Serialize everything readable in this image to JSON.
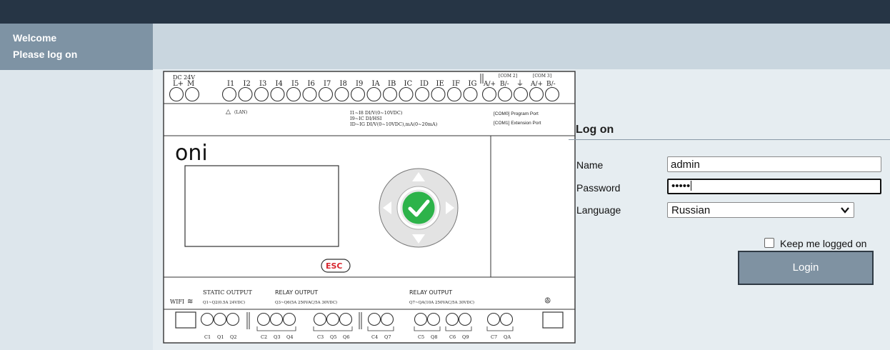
{
  "sidebar": {
    "welcome": "Welcome",
    "prompt": "Please log on"
  },
  "device": {
    "power_labels": [
      "DC 24V",
      "L+",
      "M"
    ],
    "input_labels": [
      "I1",
      "I2",
      "I3",
      "I4",
      "I5",
      "I6",
      "I7",
      "I8",
      "I9",
      "IA",
      "IB",
      "IC",
      "ID",
      "IE",
      "IF",
      "IG"
    ],
    "com2_label": "[COM 2]",
    "com3_label": "[COM 3]",
    "com_pins": [
      "A/+",
      "B/-",
      "A/+",
      "B/-"
    ],
    "lan_label": "(LAN)",
    "input_spec_lines": [
      "I1~I8 DI/V(0~10VDC)",
      "I9~IC DI/HSI",
      "ID~IG DI/V(0~10VDC),mA(0~20mA)"
    ],
    "port_lines": [
      "[COM0] Program Port",
      "[COM1] Extension Port"
    ],
    "brand": "oni",
    "esc_label": "ESC",
    "wifi_label": "WIFI",
    "outputs": [
      {
        "title": "STATIC OUTPUT",
        "spec": "Q1~Q2(0.5A 24VDC)"
      },
      {
        "title": "RELAY OUTPUT",
        "spec": "Q3~Q6(5A 250VAC/5A 30VDC)"
      },
      {
        "title": "RELAY OUTPUT",
        "spec": "Q7~QA(10A 250VAC/5A 30VDC)"
      }
    ],
    "output_terminals": [
      "C1",
      "Q1",
      "Q2",
      "C2",
      "Q3",
      "Q4",
      "C3",
      "Q5",
      "Q6",
      "C4",
      "Q7",
      "C5",
      "Q8",
      "C6",
      "Q9",
      "C7",
      "QA"
    ],
    "colors": {
      "accent_green": "#2db34a",
      "esc_red": "#d8262e"
    }
  },
  "logon": {
    "title": "Log on",
    "name_label": "Name",
    "name_value": "admin",
    "password_label": "Password",
    "password_value": "•••••",
    "language_label": "Language",
    "language_value": "Russian",
    "keep_label": "Keep me logged on",
    "login_label": "Login"
  },
  "colors": {
    "topbar": "#263545",
    "sidebar_header": "#7e93a4",
    "sidebar": "#dde6ec",
    "header_strip": "#c9d6df",
    "main": "#e6edf1",
    "login_button": "#7f92a2"
  }
}
